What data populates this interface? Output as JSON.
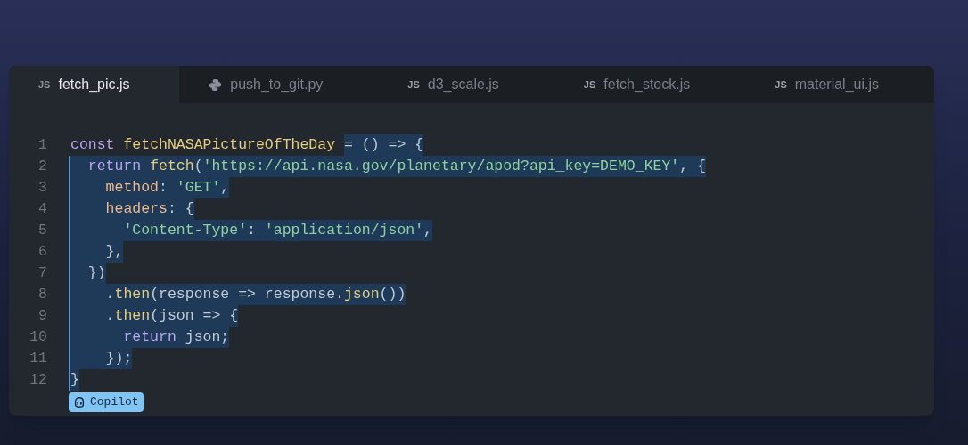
{
  "tabs": [
    {
      "label": "fetch_pic.js",
      "kind": "js",
      "badge": "JS",
      "selected": true
    },
    {
      "label": "push_to_git.py",
      "kind": "python",
      "selected": false
    },
    {
      "label": "d3_scale.js",
      "kind": "js",
      "badge": "JS",
      "selected": false
    },
    {
      "label": "fetch_stock.js",
      "kind": "js",
      "badge": "JS",
      "selected": false
    },
    {
      "label": "material_ui.js",
      "kind": "js",
      "badge": "JS",
      "selected": false
    }
  ],
  "code": [
    {
      "number": "1",
      "segments": [
        {
          "text": "const ",
          "kind": "keyword",
          "selected": false
        },
        {
          "text": "fetchNASAPictureOfTheDay ",
          "kind": "function",
          "selected": false
        },
        {
          "text": "= () => {",
          "kind": "plain",
          "selected": true
        }
      ]
    },
    {
      "number": "2",
      "segments": [
        {
          "text": "  return ",
          "kind": "keyword",
          "selected": true
        },
        {
          "text": "fetch",
          "kind": "function",
          "selected": true
        },
        {
          "text": "(",
          "kind": "plain",
          "selected": true
        },
        {
          "text": "'https://api.nasa.gov/planetary/apod?api_key=DEMO_KEY'",
          "kind": "string",
          "selected": true
        },
        {
          "text": ", {",
          "kind": "plain",
          "selected": true
        }
      ]
    },
    {
      "number": "3",
      "segments": [
        {
          "text": "    method",
          "kind": "property",
          "selected": true
        },
        {
          "text": ": ",
          "kind": "plain",
          "selected": true
        },
        {
          "text": "'GET'",
          "kind": "string",
          "selected": true
        },
        {
          "text": ",",
          "kind": "plain",
          "selected": true
        }
      ]
    },
    {
      "number": "4",
      "segments": [
        {
          "text": "    headers",
          "kind": "property",
          "selected": true
        },
        {
          "text": ": {",
          "kind": "plain",
          "selected": true
        }
      ]
    },
    {
      "number": "5",
      "segments": [
        {
          "text": "      'Content-Type'",
          "kind": "string",
          "selected": true
        },
        {
          "text": ": ",
          "kind": "plain",
          "selected": true
        },
        {
          "text": "'application/json'",
          "kind": "string",
          "selected": true
        },
        {
          "text": ",",
          "kind": "plain",
          "selected": true
        }
      ]
    },
    {
      "number": "6",
      "segments": [
        {
          "text": "    },",
          "kind": "plain",
          "selected": true
        }
      ]
    },
    {
      "number": "7",
      "segments": [
        {
          "text": "  })",
          "kind": "plain",
          "selected": true
        }
      ]
    },
    {
      "number": "8",
      "segments": [
        {
          "text": "    .",
          "kind": "plain",
          "selected": true
        },
        {
          "text": "then",
          "kind": "function",
          "selected": true
        },
        {
          "text": "(response => response.",
          "kind": "plain",
          "selected": true
        },
        {
          "text": "json",
          "kind": "function",
          "selected": true
        },
        {
          "text": "())",
          "kind": "plain",
          "selected": true
        }
      ]
    },
    {
      "number": "9",
      "segments": [
        {
          "text": "    .",
          "kind": "plain",
          "selected": true
        },
        {
          "text": "then",
          "kind": "function",
          "selected": true
        },
        {
          "text": "(json => {",
          "kind": "plain",
          "selected": true
        }
      ]
    },
    {
      "number": "10",
      "segments": [
        {
          "text": "      return",
          "kind": "keyword",
          "selected": true
        },
        {
          "text": " json;",
          "kind": "plain",
          "selected": true
        }
      ]
    },
    {
      "number": "11",
      "segments": [
        {
          "text": "    });",
          "kind": "plain",
          "selected": true
        }
      ]
    },
    {
      "number": "12",
      "segments": [
        {
          "text": "}",
          "kind": "plain",
          "selected": true
        }
      ]
    }
  ],
  "copilot_badge": {
    "label": "Copilot"
  }
}
